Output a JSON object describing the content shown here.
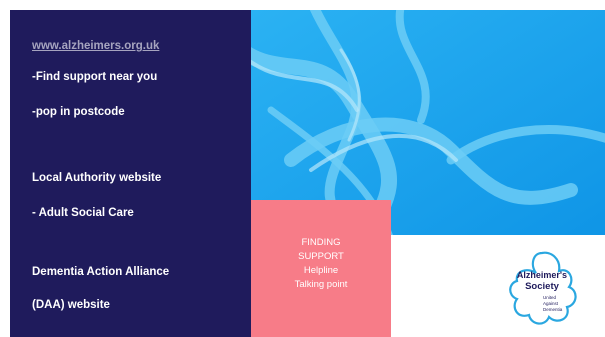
{
  "left_panel": {
    "website_link": "www.alzheimers.org.uk",
    "lines": [
      "-Find support near you",
      "-pop in postcode",
      "Local Authority website",
      "- Adult Social Care",
      "Dementia Action Alliance",
      "(DAA) website"
    ]
  },
  "support_box": {
    "lines": [
      "FINDING",
      "SUPPORT",
      "Helpline",
      "Talking point"
    ]
  },
  "logo": {
    "line1": "Alzheimer's",
    "line2": "Society",
    "tagline": [
      "United",
      "Against",
      "Dementia"
    ]
  },
  "colors": {
    "navy": "#1f1b5c",
    "sky_blue": "#1aa9f0",
    "pink": "#f77c88",
    "logo_blue": "#2aa7e0"
  }
}
